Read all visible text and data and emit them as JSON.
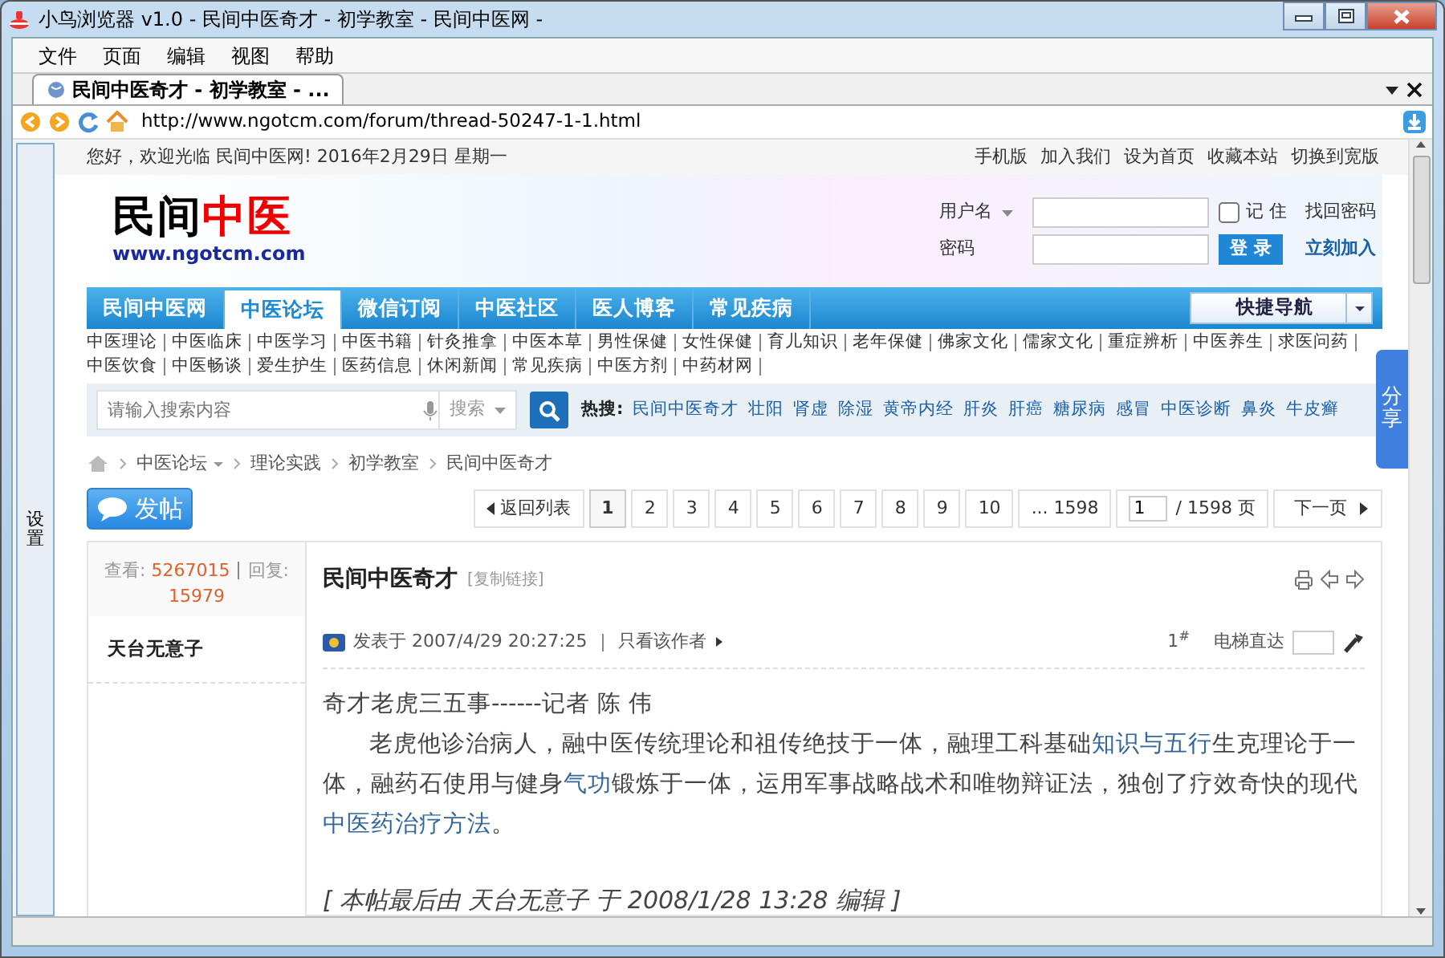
{
  "window": {
    "title": "小鸟浏览器 v1.0 - 民间中医奇才 - 初学教室 - 民间中医网 -"
  },
  "menu": [
    "文件",
    "页面",
    "编辑",
    "视图",
    "帮助"
  ],
  "tabs": [
    {
      "label": "民间中医奇才 - 初学教室 - ...",
      "selected": true
    }
  ],
  "address": {
    "url": "http://www.ngotcm.com/forum/thread-50247-1-1.html"
  },
  "side_panel": {
    "label": "设置"
  },
  "top_bar": {
    "greeting": "您好，欢迎光临 民间中医网! 2016年2月29日 星期一",
    "links": [
      "手机版",
      "加入我们",
      "设为首页",
      "收藏本站",
      "切换到宽版"
    ]
  },
  "logo": {
    "name_black": "民间",
    "name_red": "中医",
    "url": "www.ngotcm.com"
  },
  "login": {
    "username_label": "用户名",
    "password_label": "密码",
    "remember": {
      "label": "记 住",
      "checked": false
    },
    "login_button": "登 录",
    "links": [
      "找回密码",
      "立刻加入"
    ]
  },
  "nav": {
    "items": [
      {
        "label": "民间中医网",
        "selected": false
      },
      {
        "label": "中医论坛",
        "selected": true
      },
      {
        "label": "微信订阅",
        "selected": false
      },
      {
        "label": "中医社区",
        "selected": false
      },
      {
        "label": "医人博客",
        "selected": false
      },
      {
        "label": "常见疾病",
        "selected": false
      }
    ],
    "quick_nav": "快捷导航"
  },
  "sub_links": [
    [
      "中医理论",
      "中医临床",
      "中医学习",
      "中医书籍",
      "针灸推拿",
      "中医本草",
      "男性保健",
      "女性保健",
      "育儿知识",
      "老年保健",
      "佛家文化",
      "儒家文化",
      "重症辨析",
      "中医养生",
      "求医问药"
    ],
    [
      "中医饮食",
      "中医畅谈",
      "爱生护生",
      "医药信息",
      "休闲新闻",
      "常见疾病",
      "中医方剂",
      "中药材网"
    ]
  ],
  "search": {
    "placeholder": "请输入搜索内容",
    "type": "搜索",
    "hot_label": "热搜:",
    "hot": [
      "民间中医奇才",
      "壮阳",
      "肾虚",
      "除湿",
      "黄帝内经",
      "肝炎",
      "肝癌",
      "糖尿病",
      "感冒",
      "中医诊断",
      "鼻炎",
      "牛皮癣"
    ]
  },
  "share": {
    "label": "分享"
  },
  "breadcrumb": [
    "中医论坛",
    "理论实践",
    "初学教室",
    "民间中医奇才"
  ],
  "post_button": "发帖",
  "pager": {
    "back": "返回列表",
    "pages": [
      {
        "label": "1",
        "selected": true
      },
      {
        "label": "2",
        "selected": false
      },
      {
        "label": "3",
        "selected": false
      },
      {
        "label": "4",
        "selected": false
      },
      {
        "label": "5",
        "selected": false
      },
      {
        "label": "6",
        "selected": false
      },
      {
        "label": "7",
        "selected": false
      },
      {
        "label": "8",
        "selected": false
      },
      {
        "label": "9",
        "selected": false
      },
      {
        "label": "10",
        "selected": false
      },
      {
        "label": "... 1598",
        "selected": false
      }
    ],
    "page_input": "1",
    "total": "/ 1598 页",
    "next": "下一页"
  },
  "thread": {
    "views_label": "查看:",
    "views": "5267015",
    "replies_label": "回复:",
    "replies": "15979",
    "title": "民间中医奇才",
    "copy_link": "[复制链接]"
  },
  "post": {
    "author": "天台无意子",
    "posted": "发表于 2007/4/29 20:27:25",
    "only_author": "只看该作者",
    "floor": "1$^{#}$",
    "jump_label": "电梯直达",
    "heading": "奇才老虎三五事------记者 陈 伟",
    "paragraph": [
      {
        "text": "老虎他诊治病人，融中医传统理论和祖传绝技于一体，融理工科基础",
        "link": false
      },
      {
        "text": "知识与五行",
        "link": true
      },
      {
        "text": "生克理论于一体，融药石使用与健身",
        "link": false
      },
      {
        "text": "气功",
        "link": true
      },
      {
        "text": "锻炼于一体，运用军事战略战术和唯物辩证法，独创了疗效奇快的现代",
        "link": false
      },
      {
        "text": "中医药治疗方法",
        "link": true
      },
      {
        "text": "。",
        "link": false
      }
    ],
    "edit_note": "[ 本帖最后由 天台无意子 于 2008/1/28 13:28 编辑 ]"
  }
}
